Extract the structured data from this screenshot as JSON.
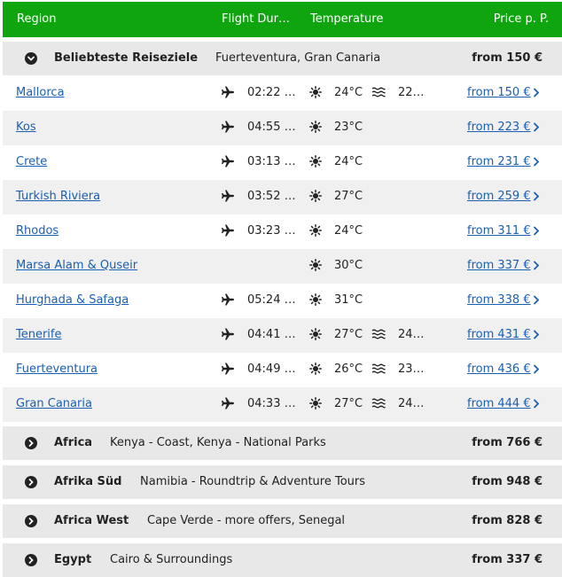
{
  "header": {
    "region": "Region",
    "flight": "Flight Dur…",
    "temperature": "Temperature",
    "price": "Price p. P."
  },
  "groups": [
    {
      "name": "Beliebteste Reiseziele",
      "subtitle": "Fuerteventura, Gran Canaria",
      "price": "from 150 €",
      "expanded": true,
      "toggle_icon": "chevron-down-icon"
    },
    {
      "name": "Africa",
      "subtitle": "Kenya - Coast, Kenya - National Parks",
      "price": "from 766 €",
      "expanded": false,
      "toggle_icon": "chevron-right-icon"
    },
    {
      "name": "Afrika Süd",
      "subtitle": "Namibia - Roundtrip & Adventure Tours",
      "price": "from 948 €",
      "expanded": false,
      "toggle_icon": "chevron-right-icon"
    },
    {
      "name": "Africa West",
      "subtitle": "Cape Verde - more offers, Senegal",
      "price": "from 828 €",
      "expanded": false,
      "toggle_icon": "chevron-right-icon"
    },
    {
      "name": "Egypt",
      "subtitle": "Cairo & Surroundings",
      "price": "from 337 €",
      "expanded": false,
      "toggle_icon": "chevron-right-icon"
    }
  ],
  "rows": [
    {
      "name": "Mallorca",
      "flight": "02:22 …",
      "temp": "24°C",
      "water": "22…",
      "price": "from 150 €"
    },
    {
      "name": "Kos",
      "flight": "04:55 …",
      "temp": "23°C",
      "water": "",
      "price": "from 223 €"
    },
    {
      "name": "Crete",
      "flight": "03:13 …",
      "temp": "24°C",
      "water": "",
      "price": "from 231 €"
    },
    {
      "name": "Turkish Riviera",
      "flight": "03:52 …",
      "temp": "27°C",
      "water": "",
      "price": "from 259 €"
    },
    {
      "name": "Rhodos",
      "flight": "03:23 …",
      "temp": "24°C",
      "water": "",
      "price": "from 311 €"
    },
    {
      "name": "Marsa Alam & Quseir",
      "flight": "",
      "temp": "30°C",
      "water": "",
      "price": "from 337 €"
    },
    {
      "name": "Hurghada & Safaga",
      "flight": "05:24 …",
      "temp": "31°C",
      "water": "",
      "price": "from 338 €"
    },
    {
      "name": "Tenerife",
      "flight": "04:41 …",
      "temp": "27°C",
      "water": "24…",
      "price": "from 431 €"
    },
    {
      "name": "Fuerteventura",
      "flight": "04:49 …",
      "temp": "26°C",
      "water": "23…",
      "price": "from 436 €"
    },
    {
      "name": "Gran Canaria",
      "flight": "04:33 …",
      "temp": "27°C",
      "water": "24…",
      "price": "from 444 €"
    }
  ],
  "icons": {
    "flight": "plane-icon",
    "temperature": "sun-icon",
    "water": "waves-icon",
    "price_link": "chevron-right-icon"
  },
  "colors": {
    "header_bg": "#0fa50f",
    "group_bg": "#e8e8e8",
    "alt_row_bg": "#f0f0f0",
    "link": "#1a5fb4"
  }
}
